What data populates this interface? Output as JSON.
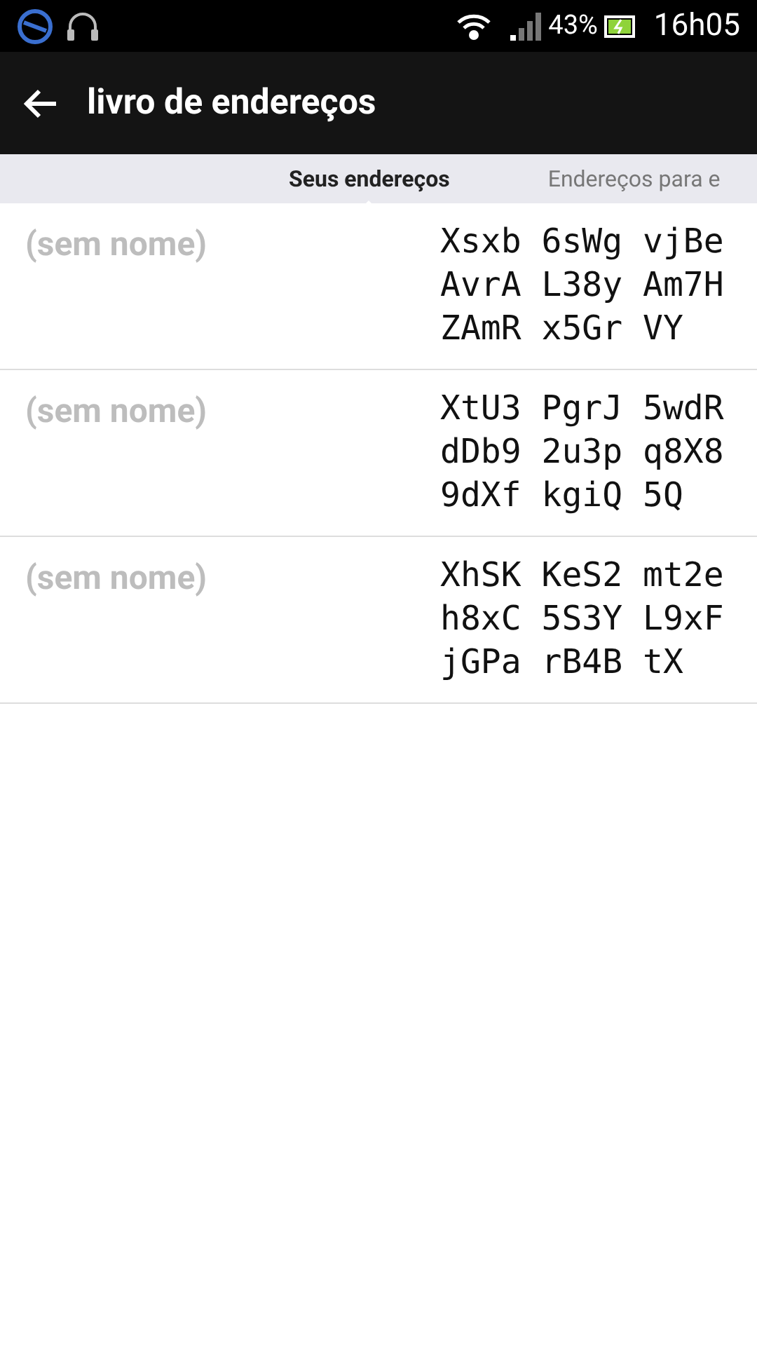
{
  "status_bar": {
    "battery": "43%",
    "time": "16h05"
  },
  "app_bar": {
    "title": "livro de endereços"
  },
  "tabs": [
    {
      "label": "Seus endereços",
      "selected": true
    },
    {
      "label": "Endereços para e",
      "selected": false
    }
  ],
  "addresses": [
    {
      "name": "(sem nome)",
      "lines": [
        "Xsxb 6sWg vjBe",
        "AvrA L38y Am7H",
        "ZAmR x5Gr VY"
      ]
    },
    {
      "name": "(sem nome)",
      "lines": [
        "XtU3 PgrJ 5wdR",
        "dDb9 2u3p q8X8",
        "9dXf kgiQ 5Q"
      ]
    },
    {
      "name": "(sem nome)",
      "lines": [
        "XhSK KeS2 mt2e",
        "h8xC 5S3Y L9xF",
        "jGPa rB4B tX"
      ]
    }
  ]
}
